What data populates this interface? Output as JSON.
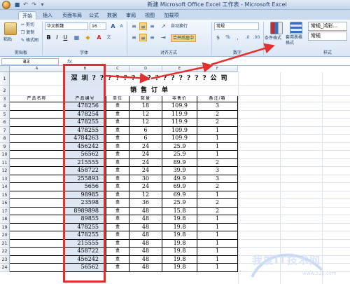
{
  "window": {
    "title": "新建 Microsoft Office Excel 工作表 - Microsoft Excel"
  },
  "tabs": [
    {
      "label": "开始",
      "active": true
    },
    {
      "label": "插入"
    },
    {
      "label": "页面布局"
    },
    {
      "label": "公式"
    },
    {
      "label": "数据"
    },
    {
      "label": "审阅"
    },
    {
      "label": "视图"
    },
    {
      "label": "加载项"
    }
  ],
  "ribbon": {
    "paste": "粘贴",
    "cut": "剪切",
    "copy": "复制",
    "format_painter": "格式刷",
    "clipboard_label": "剪贴板",
    "font_name": "华文新魏",
    "font_size": "16",
    "font_label": "字体",
    "wrap_text": "自动换行",
    "merge_center": "合并后居中",
    "alignment_label": "对齐方式",
    "number_format": "常规",
    "number_label": "数字",
    "conditional_format": "条件格式",
    "table_format": "套用表格格式",
    "style_label": "样式",
    "style_1": "常规_鸿彩...",
    "style_2": "常规"
  },
  "formula_bar": {
    "name_box": "B3",
    "fx": "fx"
  },
  "sheet": {
    "columns": [
      "A",
      "B",
      "C",
      "D",
      "E",
      "F"
    ],
    "rows": [
      "1",
      "2",
      "3",
      "4",
      "5",
      "6",
      "7",
      "8",
      "9",
      "10",
      "11",
      "12",
      "13",
      "14",
      "15",
      "16",
      "17",
      "18",
      "19",
      "20",
      "21",
      "22",
      "23",
      "24"
    ],
    "title1": "深圳???????????????公司",
    "title2": "销售订单",
    "headers": [
      "产品名称",
      "产品编号",
      "单位",
      "数量",
      "零售价",
      "备注/箱"
    ],
    "data": [
      [
        "478256",
        "盒",
        "18",
        "109.9",
        "3"
      ],
      [
        "478254",
        "盒",
        "12",
        "119.9",
        "2"
      ],
      [
        "478255",
        "盒",
        "12",
        "119.9",
        "2"
      ],
      [
        "478255",
        "盒",
        "6",
        "109.9",
        "1"
      ],
      [
        "4784263",
        "盒",
        "6",
        "109.9",
        "1"
      ],
      [
        "456242",
        "盒",
        "24",
        "25.9",
        "1"
      ],
      [
        "56562",
        "盒",
        "24",
        "25.9",
        "1"
      ],
      [
        "215555",
        "盒",
        "24",
        "89.9",
        "2"
      ],
      [
        "458722",
        "盒",
        "24",
        "39.9",
        "3"
      ],
      [
        "255893",
        "盒",
        "30",
        "49.9",
        "3"
      ],
      [
        "5656",
        "盒",
        "24",
        "69.9",
        "2"
      ],
      [
        "98985",
        "盒",
        "12",
        "69.9",
        "1"
      ],
      [
        "23598",
        "盒",
        "36",
        "25.9",
        "2"
      ],
      [
        "8989898",
        "盒",
        "48",
        "15.8",
        "2"
      ],
      [
        "89855",
        "盒",
        "48",
        "19.8",
        "1"
      ],
      [
        "478255",
        "盒",
        "48",
        "19.8",
        "1"
      ],
      [
        "478255",
        "盒",
        "48",
        "19.8",
        "1"
      ],
      [
        "215555",
        "盒",
        "48",
        "19.8",
        "1"
      ],
      [
        "458722",
        "盒",
        "48",
        "19.8",
        "1"
      ],
      [
        "456242",
        "盒",
        "48",
        "19.8",
        "1"
      ],
      [
        "56562",
        "盒",
        "48",
        "19.8",
        "1"
      ]
    ]
  },
  "watermark": {
    "main": "我爱IT技术网",
    "sub": "www.52ij.com"
  },
  "colors": {
    "highlight": "#e23030",
    "ribbon": "#dae6f5"
  }
}
